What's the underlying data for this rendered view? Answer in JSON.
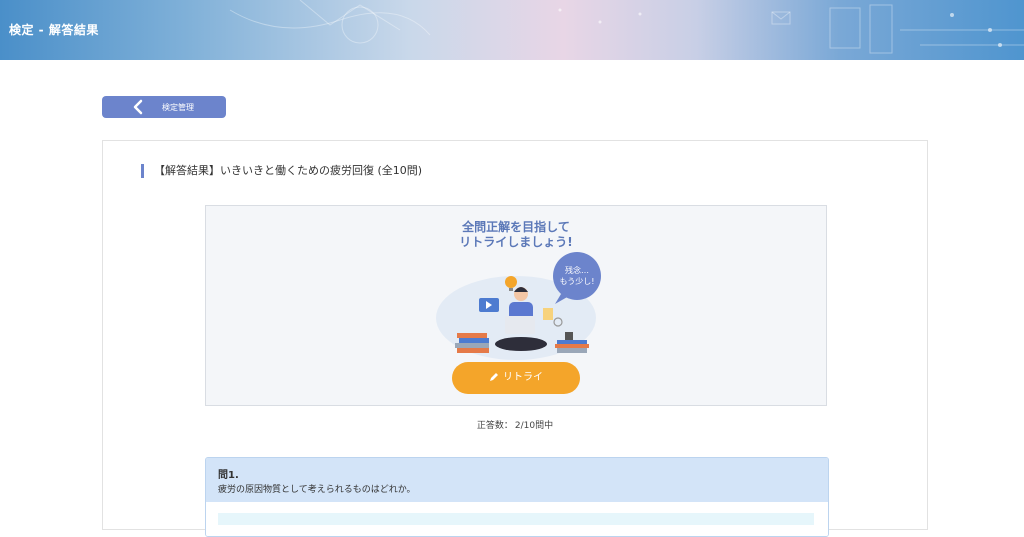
{
  "header": {
    "title": "検定 - 解答結果"
  },
  "nav": {
    "back_label": "検定管理"
  },
  "page": {
    "title": "【解答結果】いきいきと働くための疲労回復 (全10問)"
  },
  "result": {
    "message_line1": "全問正解を目指して",
    "message_line2": "リトライしましょう!",
    "bubble_line1": "残念…",
    "bubble_line2": "もう少し!",
    "retry_label": "リトライ",
    "score_label": "正答数：",
    "score_value": "2/10問中"
  },
  "question": {
    "number": "問1.",
    "text": "疲労の原因物質として考えられるものはどれか。"
  },
  "colors": {
    "accent": "#6c84cc",
    "retry": "#f4a52a",
    "question_header": "#d3e4f8"
  },
  "icons": {
    "back": "chevron-left-icon",
    "retry": "pencil-icon"
  }
}
